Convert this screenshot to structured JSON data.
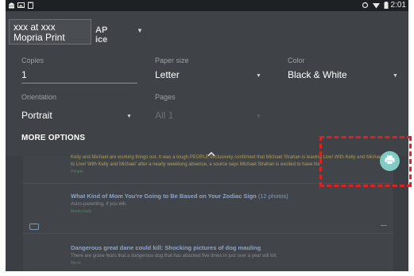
{
  "status_bar": {
    "time": "2:01",
    "left_icons": [
      "android-icon",
      "image-icon",
      "clipboard-icon"
    ],
    "right_icons": [
      "sync-icon",
      "wifi-icon",
      "battery-icon"
    ]
  },
  "printer": {
    "name_line1": "xxx at xxx",
    "name_line2": "Mopria Print",
    "behind_line1": "AP",
    "behind_line2": "ice"
  },
  "options": {
    "copies": {
      "label": "Copies",
      "value": "1"
    },
    "paper_size": {
      "label": "Paper size",
      "value": "Letter"
    },
    "color": {
      "label": "Color",
      "value": "Black & White"
    },
    "orientation": {
      "label": "Orientation",
      "value": "Portrait"
    },
    "pages": {
      "label": "Pages",
      "value": "All 1"
    },
    "more_options": "MORE OPTIONS"
  },
  "document": {
    "items": [
      {
        "body": "Kelly and Michael are working things out. It was a tough PEOPLE exclusively confirmed that Michael Strahan is leaving Live! With Kelly and Michael",
        "body2": "to Live! With Kelly and Michael' after a nearly weeklong absence, a source says Michael Strahan is excited to have his",
        "source": "People"
      },
      {
        "title": "What Kind of Mom You're Going to Be Based on Your Zodiac Sign",
        "title_suffix": " (12 photos)",
        "body": "Astro-parenting, if you will.",
        "source": "Moms Daily"
      },
      {
        "title": "Dangerous great dane could kill: Shocking pictures of dog mauling",
        "body": "There are grave fears that a dangerous dog that has attacked five times in just over a year will kill.",
        "source": "Mirror"
      }
    ]
  },
  "colors": {
    "panel": "#3f4247",
    "fab": "#80cbc4",
    "highlight": "#dd2222",
    "link": "#8ea3c4"
  }
}
